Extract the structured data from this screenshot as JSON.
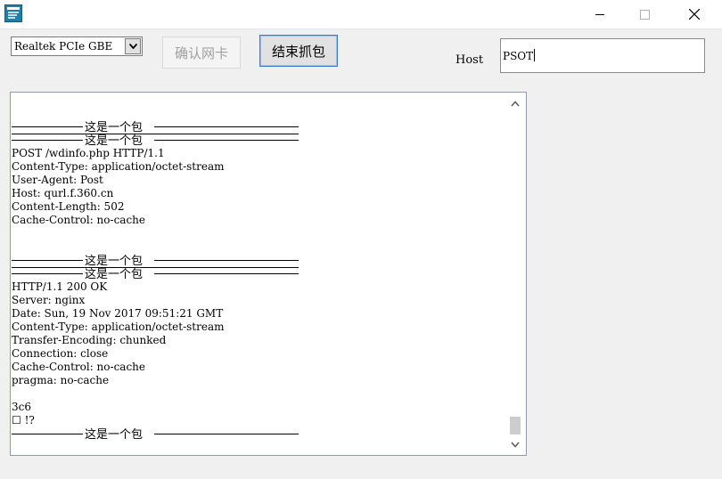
{
  "window": {
    "icon": "app-window-icon",
    "controls": [
      "minimize-icon",
      "maximize-icon",
      "close-icon"
    ]
  },
  "toolbar": {
    "adapter_selected": "Realtek PCIe GBE",
    "confirm_button": "确认网卡",
    "stop_button": "结束抓包",
    "host_label": "Host",
    "host_value": "PSOT"
  },
  "output": {
    "separator_label": "这是一个包",
    "block1": [
      "POST /wdinfo.php HTTP/1.1",
      "Content-Type: application/octet-stream",
      "User-Agent: Post",
      "Host: qurl.f.360.cn",
      "Content-Length: 502",
      "Cache-Control: no-cache"
    ],
    "block2": [
      "HTTP/1.1 200 OK",
      "Server: nginx",
      "Date: Sun, 19 Nov 2017 09:51:21 GMT",
      "Content-Type: application/octet-stream",
      "Transfer-Encoding: chunked",
      "Connection: close",
      "Cache-Control: no-cache",
      "pragma: no-cache"
    ],
    "block3": [
      "3c6",
      "☐ !?"
    ]
  }
}
